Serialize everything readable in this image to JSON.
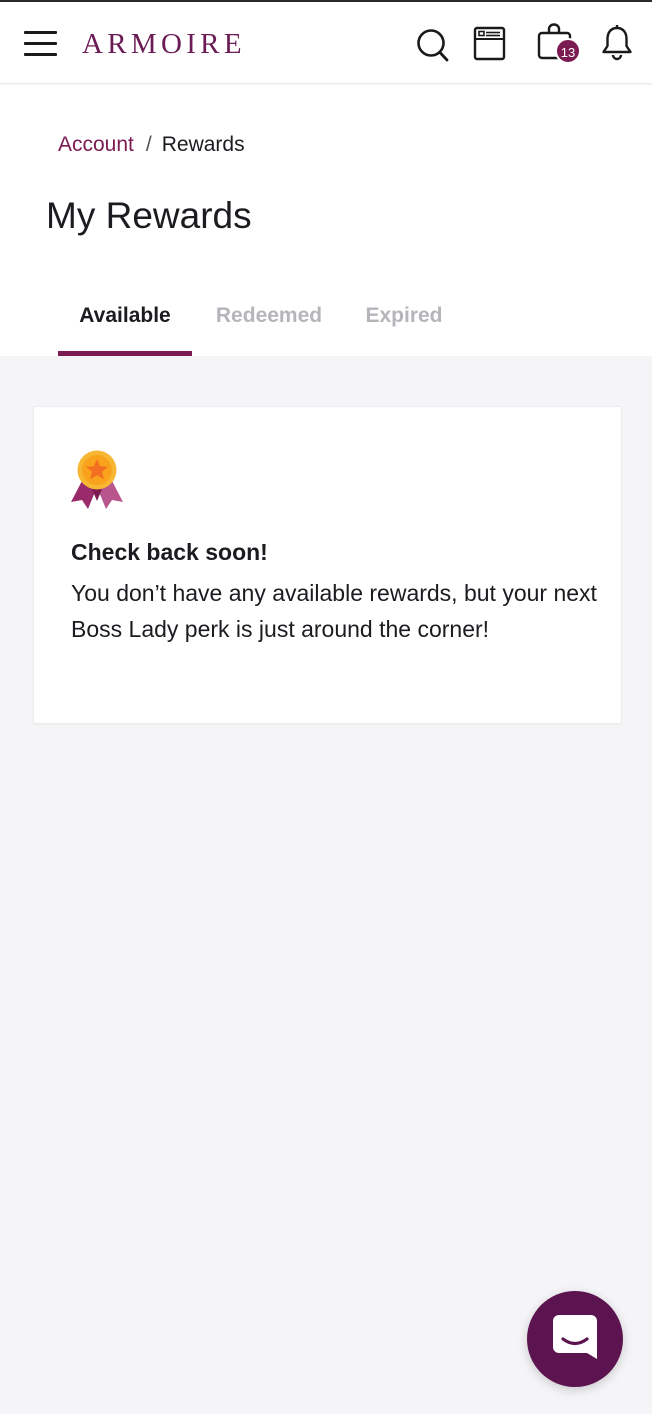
{
  "header": {
    "logo_text": "ARMOIRE",
    "cart_count": "13",
    "icons": [
      "menu-icon",
      "search-icon",
      "closet-icon",
      "shopping-bag-icon",
      "bell-icon"
    ]
  },
  "breadcrumb": {
    "parent": "Account",
    "separator": "/",
    "current": "Rewards"
  },
  "page": {
    "title": "My Rewards"
  },
  "tabs": [
    {
      "label": "Available",
      "active": true
    },
    {
      "label": "Redeemed",
      "active": false
    },
    {
      "label": "Expired",
      "active": false
    }
  ],
  "empty_state": {
    "icon": "award-ribbon-icon",
    "title": "Check back soon!",
    "body": "You don’t have any available rewards, but your next Boss Lady perk is just around the corner!"
  },
  "chat": {
    "icon": "chat-icon"
  },
  "colors": {
    "brand": "#7c1a52",
    "chat_button": "#5c1450",
    "background": "#f5f4f7",
    "inactive_tab": "#b6b5ba",
    "medal": "#f9a21b"
  }
}
